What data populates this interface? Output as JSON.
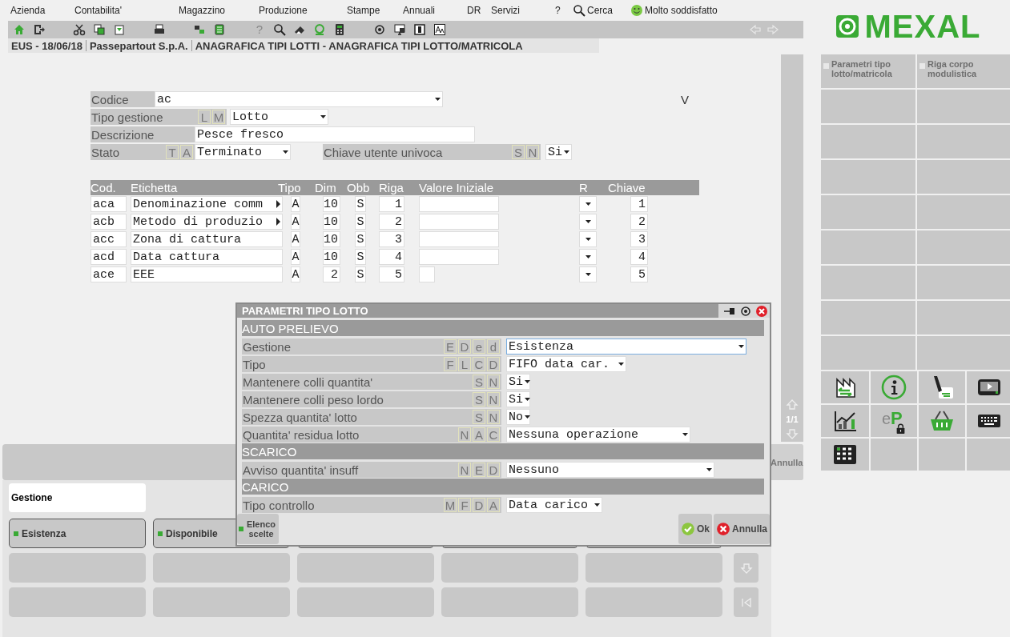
{
  "toolbar_help": "?",
  "menu": [
    {
      "label": "Azienda",
      "kind": "text"
    },
    {
      "label": "Contabilita'",
      "kind": "text"
    },
    {
      "label": "Magazzino",
      "kind": "text"
    },
    {
      "label": "Produzione",
      "kind": "text"
    },
    {
      "label": "Stampe",
      "kind": "text"
    },
    {
      "label": "Annuali",
      "kind": "text"
    },
    {
      "label": "DR",
      "kind": "text"
    },
    {
      "label": "Servizi",
      "kind": "text"
    },
    {
      "label": "?",
      "kind": "text"
    },
    {
      "label": "Cerca",
      "kind": "search"
    },
    {
      "label": "Molto soddisfatto",
      "kind": "feedback"
    }
  ],
  "breadcrumb": [
    "EUS - 18/06/18",
    "Passepartout S.p.A.",
    "ANAGRAFICA TIPI LOTTI - ANAGRAFICA TIPI LOTTO/MATRICOLA"
  ],
  "form": {
    "codice": {
      "label": "Codice",
      "value": "ac"
    },
    "flag": "V",
    "tipo_gestione": {
      "label": "Tipo gestione",
      "keys": [
        "L",
        "M"
      ],
      "value": "Lotto"
    },
    "descrizione": {
      "label": "Descrizione",
      "value": "Pesce fresco"
    },
    "stato": {
      "label": "Stato",
      "keys": [
        "T",
        "A"
      ],
      "value": "Terminato"
    },
    "chiave_utente": {
      "label": "Chiave utente univoca",
      "keys": [
        "S",
        "N"
      ],
      "value": "Si"
    }
  },
  "table": {
    "columns": [
      "Cod.",
      "Etichetta",
      "Tipo",
      "Dim",
      "Obb",
      "Riga",
      "Valore Iniziale",
      "R",
      "Chiave"
    ],
    "rows": [
      {
        "cod": "aca",
        "etichetta": "Denominazione comm",
        "more": true,
        "tipo": "A",
        "dim": "10",
        "obb": "S",
        "riga": "1",
        "chiave": "1"
      },
      {
        "cod": "acb",
        "etichetta": "Metodo di produzio",
        "more": true,
        "tipo": "A",
        "dim": "10",
        "obb": "S",
        "riga": "2",
        "chiave": "2"
      },
      {
        "cod": "acc",
        "etichetta": "Zona di cattura",
        "more": false,
        "tipo": "A",
        "dim": "10",
        "obb": "S",
        "riga": "3",
        "chiave": "3"
      },
      {
        "cod": "acd",
        "etichetta": "Data cattura",
        "more": false,
        "tipo": "A",
        "dim": "10",
        "obb": "S",
        "riga": "4",
        "chiave": "4"
      },
      {
        "cod": "ace",
        "etichetta": "EEE",
        "more": false,
        "tipo": "A",
        "dim": "2",
        "obb": "S",
        "riga": "5",
        "chiave": "5"
      }
    ]
  },
  "scroll": {
    "page": "1/1"
  },
  "action_bar": {
    "button": "Annulla"
  },
  "tabs": [
    {
      "label": "Gestione",
      "selected": true
    }
  ],
  "buttons": [
    {
      "label": "Esistenza"
    },
    {
      "label": "Disponibile"
    }
  ],
  "dialog": {
    "title": "PARAMETRI TIPO LOTTO",
    "sections": [
      {
        "title": "AUTO PRELIEVO",
        "rows": [
          {
            "label": "Gestione",
            "keys": [
              "E",
              "D",
              "e",
              "d"
            ],
            "value": "Esistenza",
            "focused": true
          },
          {
            "label": "Tipo",
            "keys": [
              "F",
              "L",
              "C",
              "D"
            ],
            "value": "FIFO data car.",
            "focused": false
          },
          {
            "label": "Mantenere colli quantita'",
            "keys": [
              "S",
              "N"
            ],
            "value": "Si",
            "focused": false
          },
          {
            "label": "Mantenere colli peso lordo",
            "keys": [
              "S",
              "N"
            ],
            "value": "Si",
            "focused": false
          },
          {
            "label": "Spezza quantita' lotto",
            "keys": [
              "S",
              "N"
            ],
            "value": "No",
            "focused": false
          },
          {
            "label": "Quantita' residua lotto",
            "keys": [
              "N",
              "A",
              "C"
            ],
            "value": "Nessuna operazione",
            "focused": false
          }
        ]
      },
      {
        "title": "SCARICO",
        "rows": [
          {
            "label": "Avviso quantita' insuff",
            "keys": [
              "N",
              "E",
              "D"
            ],
            "value": "Nessuno",
            "focused": false
          }
        ]
      },
      {
        "title": "CARICO",
        "rows": [
          {
            "label": "Tipo controllo",
            "keys": [
              "M",
              "F",
              "D",
              "A"
            ],
            "value": "Data carico",
            "focused": false
          }
        ]
      }
    ],
    "buttons": [
      {
        "label": "Elenco scelte",
        "kind": "list"
      },
      {
        "label": "Ok",
        "kind": "ok"
      },
      {
        "label": "Annulla",
        "kind": "cancel"
      }
    ]
  },
  "logo": "MEXAL",
  "ep_icon_letters": [
    "e",
    "P"
  ],
  "side_panel": {
    "items": [
      {
        "label": "Parametri tipo lotto/matricola"
      },
      {
        "label": "Riga corpo modulistica"
      }
    ]
  }
}
